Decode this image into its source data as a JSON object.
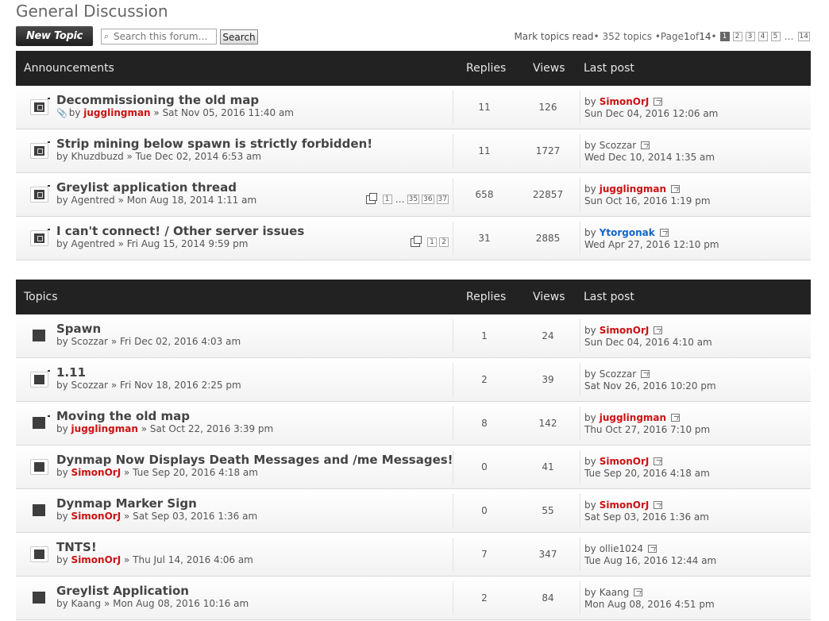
{
  "page_title": "General Discussion",
  "toolbar": {
    "new_topic_label": "New Topic",
    "search_placeholder": "Search this forum…",
    "search_button": "Search"
  },
  "pagination": {
    "mark_read": "Mark topics read",
    "summary": " • 352 topics • ",
    "page_label": "Page ",
    "current": "1",
    "of_label": " of ",
    "total": "14",
    "bullet": " •",
    "pages": [
      "1",
      "2",
      "3",
      "4",
      "5"
    ],
    "ellipsis": "…",
    "last": "14"
  },
  "colors": {
    "header_bg": "#222222",
    "user_red": "#cc1111",
    "user_blue": "#1166cc",
    "user_green": "#008800"
  },
  "announcements": {
    "heading": "Announcements",
    "col_replies": "Replies",
    "col_views": "Views",
    "col_last": "Last post",
    "rows": [
      {
        "title": "Decommissioning the old map",
        "by": "by ",
        "author": "jugglingman",
        "date": " » Sat Nov 05, 2016 11:40 am",
        "replies": "11",
        "views": "126",
        "last_by": "by",
        "last_user": "SimonOrJ",
        "last_date": "Sun Dec 04, 2016 12:06 am"
      },
      {
        "title": "Strip mining below spawn is strictly forbidden!",
        "by": "by ",
        "author": "Khuzdbuzd",
        "date": " » Tue Dec 02, 2014 6:53 am",
        "replies": "11",
        "views": "1727",
        "last_by": "by",
        "last_user": "Scozzar",
        "last_date": "Wed Dec 10, 2014 1:35 am"
      },
      {
        "title": "Greylist application thread",
        "by": "by ",
        "author": "Agentred",
        "date": " » Mon Aug 18, 2014 1:11 am",
        "pages": [
          "1",
          "35",
          "36",
          "37"
        ],
        "pages_ellipsis": "…",
        "replies": "658",
        "views": "22857",
        "last_by": "by",
        "last_user": "jugglingman",
        "last_date": "Sun Oct 16, 2016 1:19 pm"
      },
      {
        "title": "I can't connect! / Other server issues",
        "by": "by ",
        "author": "Agentred",
        "date": " » Fri Aug 15, 2014 9:59 pm",
        "pages": [
          "1",
          "2"
        ],
        "replies": "31",
        "views": "2885",
        "last_by": "by",
        "last_user": "Ytorgonak",
        "last_date": "Wed Apr 27, 2016 12:10 pm"
      }
    ]
  },
  "topics": {
    "heading": "Topics",
    "col_replies": "Replies",
    "col_views": "Views",
    "col_last": "Last post",
    "rows": [
      {
        "title": "Spawn",
        "by": "by ",
        "author": "Scozzar",
        "date": " » Fri Dec 02, 2016 4:03 am",
        "replies": "1",
        "views": "24",
        "last_by": "by",
        "last_user": "SimonOrJ",
        "last_date": "Sun Dec 04, 2016 4:10 am"
      },
      {
        "title": "1.11",
        "by": "by ",
        "author": "Scozzar",
        "date": " » Fri Nov 18, 2016 2:25 pm",
        "replies": "2",
        "views": "39",
        "last_by": "by",
        "last_user": "Scozzar",
        "last_date": "Sat Nov 26, 2016 10:20 pm"
      },
      {
        "title": "Moving the old map",
        "by": "by ",
        "author": "jugglingman",
        "date": " » Sat Oct 22, 2016 3:39 pm",
        "replies": "8",
        "views": "142",
        "last_by": "by",
        "last_user": "jugglingman",
        "last_date": "Thu Oct 27, 2016 7:10 pm"
      },
      {
        "title": "Dynmap Now Displays Death Messages and /me Messages!",
        "by": "by ",
        "author": "SimonOrJ",
        "date": " » Tue Sep 20, 2016 4:18 am",
        "replies": "0",
        "views": "41",
        "last_by": "by",
        "last_user": "SimonOrJ",
        "last_date": "Tue Sep 20, 2016 4:18 am"
      },
      {
        "title": "Dynmap Marker Sign",
        "by": "by ",
        "author": "SimonOrJ",
        "date": " » Sat Sep 03, 2016 1:36 am",
        "replies": "0",
        "views": "55",
        "last_by": "by",
        "last_user": "SimonOrJ",
        "last_date": "Sat Sep 03, 2016 1:36 am"
      },
      {
        "title": "TNTS!",
        "by": "by ",
        "author": "SimonOrJ",
        "date": " » Thu Jul 14, 2016 4:06 am",
        "replies": "7",
        "views": "347",
        "last_by": "by",
        "last_user": "ollie1024",
        "last_date": "Tue Aug 16, 2016 12:44 am"
      },
      {
        "title": "Greylist Application",
        "by": "by ",
        "author": "Kaang",
        "date": " » Mon Aug 08, 2016 10:16 am",
        "replies": "2",
        "views": "84",
        "last_by": "by",
        "last_user": "Kaang",
        "last_date": "Mon Aug 08, 2016 4:51 pm"
      }
    ]
  }
}
